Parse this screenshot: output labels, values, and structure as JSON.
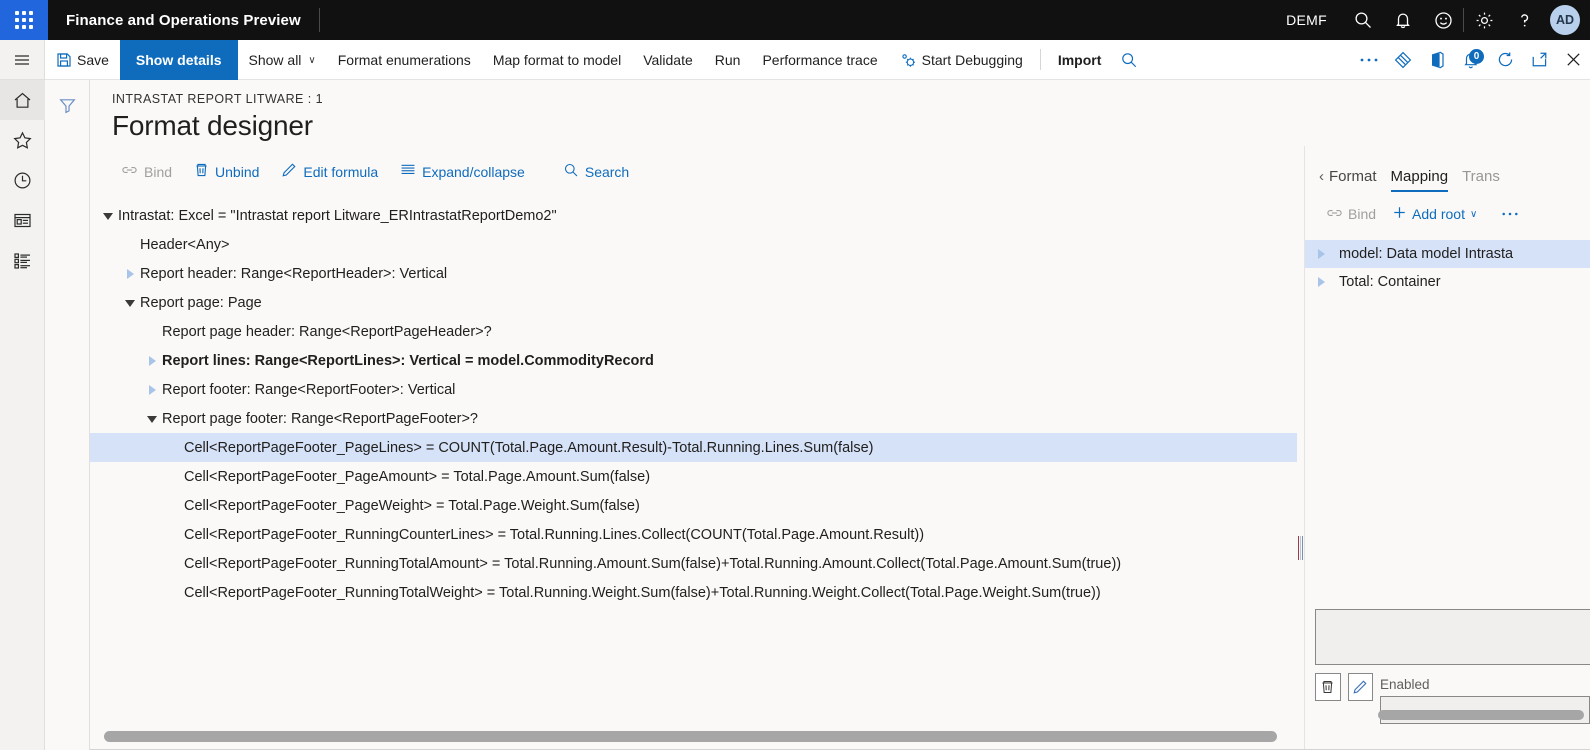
{
  "header": {
    "app_title": "Finance and Operations Preview",
    "company": "DEMF",
    "waffle_icon": "waffle-grid-icon",
    "icons": [
      "search-icon",
      "notifications-bell-icon",
      "feedback-smiley-icon",
      "settings-gear-icon",
      "help-question-icon"
    ],
    "avatar_initials": "AD"
  },
  "rail": {
    "items": [
      {
        "name": "hamburger-menu-icon",
        "label": "Menu"
      },
      {
        "name": "home-icon",
        "label": "Home"
      },
      {
        "name": "favorites-star-icon",
        "label": "Favorites"
      },
      {
        "name": "recent-clock-icon",
        "label": "Recent"
      },
      {
        "name": "workspaces-window-icon",
        "label": "Workspaces"
      },
      {
        "name": "modules-list-icon",
        "label": "Modules"
      }
    ]
  },
  "commandbar": {
    "save_label": "Save",
    "show_details_label": "Show details",
    "show_all_label": "Show all",
    "format_enumerations_label": "Format enumerations",
    "map_format_to_model_label": "Map format to model",
    "validate_label": "Validate",
    "run_label": "Run",
    "performance_trace_label": "Performance trace",
    "start_debugging_label": "Start Debugging",
    "import_label": "Import",
    "notification_count": "0",
    "right_icons": [
      "search-icon",
      "overflow-ellipsis-icon",
      "attach-diamond-icon",
      "office-app-icon",
      "notifications-icon",
      "refresh-icon",
      "popout-icon",
      "close-icon"
    ]
  },
  "page": {
    "breadcrumb": "INTRASTAT REPORT LITWARE : 1",
    "title": "Format designer",
    "filter_icon": "filter-funnel-icon"
  },
  "tree_actions": {
    "bind": {
      "label": "Bind",
      "icon": "bind-link-icon",
      "disabled": true
    },
    "unbind": {
      "label": "Unbind",
      "icon": "unbind-trash-icon",
      "disabled": false
    },
    "edit_formula": {
      "label": "Edit formula",
      "icon": "edit-pencil-icon",
      "disabled": false
    },
    "expand_collapse": {
      "label": "Expand/collapse",
      "icon": "expand-collapse-list-icon",
      "disabled": false
    },
    "search": {
      "label": "Search",
      "icon": "search-icon",
      "disabled": false
    }
  },
  "format_tree": [
    {
      "label": "Intrastat: Excel = \"Intrastat report Litware_ERIntrastatReportDemo2\"",
      "indent": 0,
      "toggle": "open",
      "bold": false,
      "selected": false
    },
    {
      "label": "Header<Any>",
      "indent": 1,
      "toggle": "none",
      "bold": false,
      "selected": false
    },
    {
      "label": "Report header: Range<ReportHeader>: Vertical",
      "indent": 1,
      "toggle": "closed",
      "bold": false,
      "selected": false
    },
    {
      "label": "Report page: Page",
      "indent": 1,
      "toggle": "open",
      "bold": false,
      "selected": false
    },
    {
      "label": "Report page header: Range<ReportPageHeader>?",
      "indent": 2,
      "toggle": "none",
      "bold": false,
      "selected": false
    },
    {
      "label": "Report lines: Range<ReportLines>: Vertical = model.CommodityRecord",
      "indent": 2,
      "toggle": "closed",
      "bold": true,
      "selected": false
    },
    {
      "label": "Report footer: Range<ReportFooter>: Vertical",
      "indent": 2,
      "toggle": "closed",
      "bold": false,
      "selected": false
    },
    {
      "label": "Report page footer: Range<ReportPageFooter>?",
      "indent": 2,
      "toggle": "open",
      "bold": false,
      "selected": false
    },
    {
      "label": "Cell<ReportPageFooter_PageLines> = COUNT(Total.Page.Amount.Result)-Total.Running.Lines.Sum(false)",
      "indent": 3,
      "toggle": "none",
      "bold": false,
      "selected": true
    },
    {
      "label": "Cell<ReportPageFooter_PageAmount> = Total.Page.Amount.Sum(false)",
      "indent": 3,
      "toggle": "none",
      "bold": false,
      "selected": false
    },
    {
      "label": "Cell<ReportPageFooter_PageWeight> = Total.Page.Weight.Sum(false)",
      "indent": 3,
      "toggle": "none",
      "bold": false,
      "selected": false
    },
    {
      "label": "Cell<ReportPageFooter_RunningCounterLines> = Total.Running.Lines.Collect(COUNT(Total.Page.Amount.Result))",
      "indent": 3,
      "toggle": "none",
      "bold": false,
      "selected": false
    },
    {
      "label": "Cell<ReportPageFooter_RunningTotalAmount> = Total.Running.Amount.Sum(false)+Total.Running.Amount.Collect(Total.Page.Amount.Sum(true))",
      "indent": 3,
      "toggle": "none",
      "bold": false,
      "selected": false
    },
    {
      "label": "Cell<ReportPageFooter_RunningTotalWeight> = Total.Running.Weight.Sum(false)+Total.Running.Weight.Collect(Total.Page.Weight.Sum(true))",
      "indent": 3,
      "toggle": "none",
      "bold": false,
      "selected": false
    }
  ],
  "side_panel": {
    "tabs": [
      {
        "label": "Format",
        "active": false,
        "back_chevron": true,
        "faded": false
      },
      {
        "label": "Mapping",
        "active": true,
        "back_chevron": false,
        "faded": false
      },
      {
        "label": "Trans",
        "active": false,
        "back_chevron": false,
        "faded": true
      }
    ],
    "actions": {
      "bind": {
        "label": "Bind",
        "icon": "bind-link-icon",
        "disabled": true
      },
      "add_root": {
        "label": "Add root",
        "icon": "plus-icon",
        "disabled": false
      },
      "overflow": {
        "label": "...",
        "icon": "overflow-ellipsis-icon",
        "disabled": false
      }
    },
    "tree": [
      {
        "label": "model: Data model Intrasta",
        "toggle": "closed",
        "selected": true
      },
      {
        "label": "Total: Container",
        "toggle": "closed",
        "selected": false
      }
    ],
    "formula_value": "",
    "delete_icon": "trash-icon",
    "edit_icon": "edit-pencil-icon",
    "enabled_label": "Enabled",
    "enabled_value": ""
  },
  "colors": {
    "accent": "#0f6cbd",
    "header_bg": "#111111",
    "waffle_bg": "#2266dd",
    "selection": "#d6e2f7",
    "page_bg": "#faf9f8",
    "avatar_bg": "#b9d0ec"
  }
}
